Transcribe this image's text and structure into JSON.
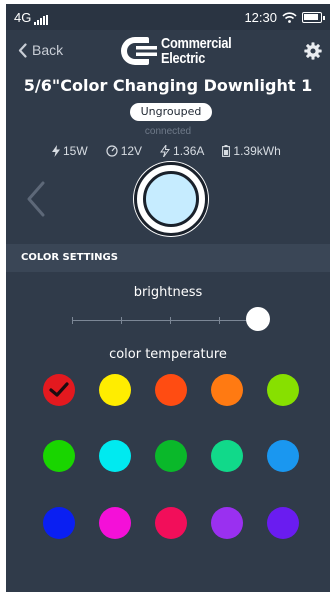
{
  "status_bar": {
    "network": "4G",
    "time": "12:30"
  },
  "header": {
    "back_label": "Back",
    "logo_line1": "Commercial",
    "logo_line2": "Electric"
  },
  "device": {
    "title": "5/6\"Color Changing Downlight 1",
    "group": "Ungrouped",
    "status": "connected",
    "stats": {
      "power": "15W",
      "voltage": "12V",
      "current": "1.36A",
      "energy": "1.39kWh"
    },
    "current_color": "#c6ecff"
  },
  "settings": {
    "section_title": "COLOR SETTINGS",
    "brightness_label": "brightness",
    "brightness_level": 0.95,
    "color_temp_label": "color temperature"
  },
  "swatches": [
    [
      "#e3191f",
      "#ffed00",
      "#ff4c12",
      "#ff7a12",
      "#87e000"
    ],
    [
      "#19d500",
      "#00eaf0",
      "#0ab82a",
      "#11d98a",
      "#1a97f0"
    ],
    [
      "#0a1ff2",
      "#f410d8",
      "#f20e5a",
      "#9a30f0",
      "#6a1cf0"
    ]
  ],
  "selected_swatch": 0
}
